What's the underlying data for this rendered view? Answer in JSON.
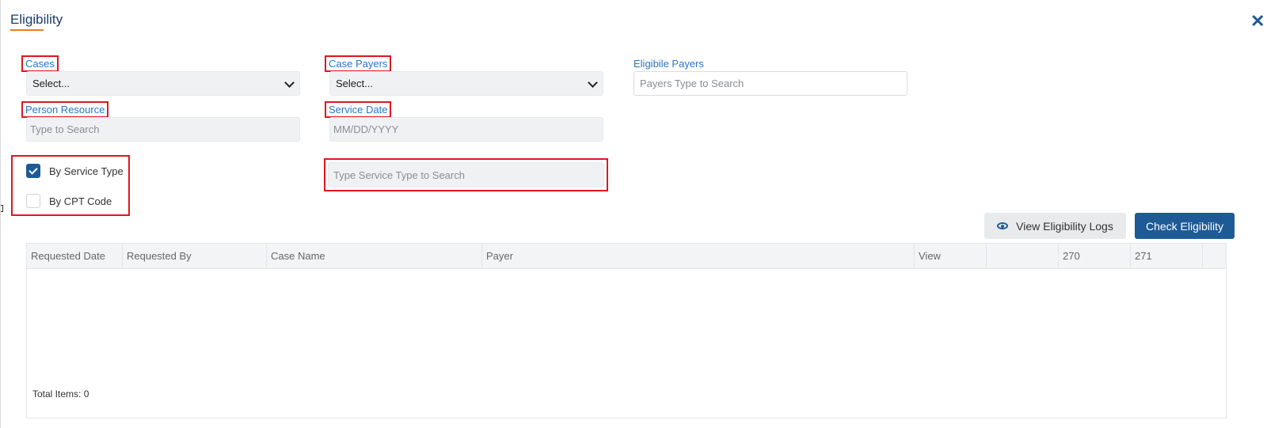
{
  "header": {
    "title": "Eligibility",
    "accent_color": "#e67e22",
    "close_icon": "close-icon"
  },
  "form": {
    "cases": {
      "label": "Cases",
      "value": "Select..."
    },
    "case_payers": {
      "label": "Case Payers",
      "value": "Select..."
    },
    "eligible_payers": {
      "label": "Eligibile Payers",
      "placeholder": "Payers Type to Search"
    },
    "person_resource": {
      "label": "Person Resource",
      "placeholder": "Type to Search"
    },
    "service_date": {
      "label": "Service Date",
      "placeholder": "MM/DD/YYYY"
    },
    "by_service_type": {
      "label": "By Service Type",
      "checked": true
    },
    "by_cpt_code": {
      "label": "By CPT Code",
      "checked": false
    },
    "service_type_search": {
      "placeholder": "Type Service Type to Search"
    }
  },
  "actions": {
    "view_logs_label": "View Eligibility Logs",
    "check_label": "Check Eligibility",
    "primary_color": "#1d5a96"
  },
  "table": {
    "columns": [
      "Requested Date",
      "Requested By",
      "Case Name",
      "Payer",
      "View",
      "",
      "270",
      "271",
      ""
    ],
    "rows": []
  },
  "footer": {
    "total_items": "Total Items: 0"
  },
  "highlight_color": "#e0161f"
}
